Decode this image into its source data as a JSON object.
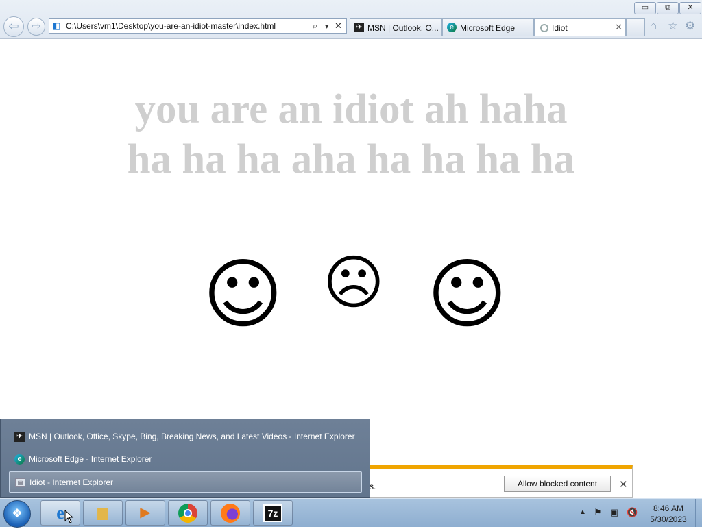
{
  "browser": {
    "window_buttons": {
      "minimize": "▭",
      "restore": "⧉",
      "close": "✕"
    },
    "address": {
      "url": "C:\\Users\\vm1\\Desktop\\you-are-an-idiot-master\\index.html",
      "search_icon": "⌕",
      "dropdown_icon": "▾",
      "stop_icon": "✕"
    },
    "tabs": [
      {
        "label": "MSN | Outlook, O...",
        "icon": "msn-icon"
      },
      {
        "label": "Microsoft Edge",
        "icon": "edge-icon"
      },
      {
        "label": "Idiot",
        "icon": "loading-icon",
        "active": true
      }
    ],
    "tab_close": "✕",
    "right_icons": {
      "home": "⌂",
      "favorites": "☆",
      "settings": "⚙"
    }
  },
  "page": {
    "headline_line1": "you are an idiot ah haha",
    "headline_line2": "ha ha ha aha ha ha ha ha",
    "faces": [
      "☺",
      "☹",
      "☺"
    ]
  },
  "notification": {
    "text_fragment": "s.",
    "button_label": "Allow blocked content",
    "close": "✕"
  },
  "jumplist": {
    "items": [
      {
        "label": "MSN | Outlook, Office, Skype, Bing, Breaking News, and Latest Videos - Internet Explorer",
        "icon": "msn-icon"
      },
      {
        "label": "Microsoft Edge - Internet Explorer",
        "icon": "edge-icon"
      },
      {
        "label": "Idiot - Internet Explorer",
        "icon": "page-icon",
        "selected": true
      }
    ]
  },
  "taskbar": {
    "clock_time": "8:46 AM",
    "clock_date": "5/30/2023",
    "apps": [
      "internet-explorer",
      "file-explorer",
      "media-player",
      "chrome",
      "firefox",
      "7zip"
    ],
    "sevenzip_label": "7z"
  }
}
